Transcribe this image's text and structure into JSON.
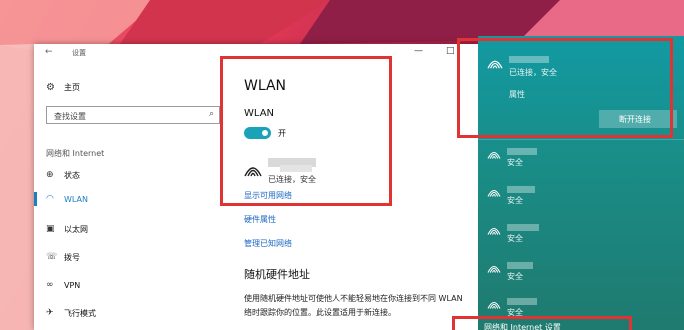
{
  "settings_window": {
    "title": "设置",
    "controls": {
      "minimize": "—",
      "maximize": "□"
    }
  },
  "sidebar": {
    "home": "主页",
    "search_placeholder": "查找设置",
    "section": "网络和 Internet",
    "items": [
      {
        "label": "状态",
        "icon": "globe-icon",
        "active": false
      },
      {
        "label": "WLAN",
        "icon": "wifi-icon",
        "active": true
      },
      {
        "label": "以太网",
        "icon": "ethernet-icon",
        "active": false
      },
      {
        "label": "拨号",
        "icon": "dialup-icon",
        "active": false
      },
      {
        "label": "VPN",
        "icon": "vpn-icon",
        "active": false
      },
      {
        "label": "飞行模式",
        "icon": "airplane-icon",
        "active": false
      }
    ]
  },
  "content": {
    "heading": "WLAN",
    "subheading": "WLAN",
    "toggle_state": "开",
    "connected_status": "已连接，安全",
    "links": [
      "显示可用网络",
      "硬件属性",
      "管理已知网络"
    ],
    "random_heading": "随机硬件地址",
    "random_desc_line1": "使用随机硬件地址可使他人不能轻易地在你连接到不同 WLAN",
    "random_desc_line2": "络时跟踪你的位置。此设置适用于新连接。"
  },
  "flyout": {
    "connected_status": "已连接，安全",
    "properties_link": "属性",
    "disconnect_button": "断开连接",
    "other_networks": [
      "安全",
      "安全",
      "安全",
      "安全",
      "安全"
    ],
    "settings_link": "网络和 Internet 设置"
  },
  "colors": {
    "accent": "#1c7fc4",
    "toggle_on": "#1aa3b8",
    "flyout_bg": "#129aa2",
    "highlight": "#e03434"
  }
}
